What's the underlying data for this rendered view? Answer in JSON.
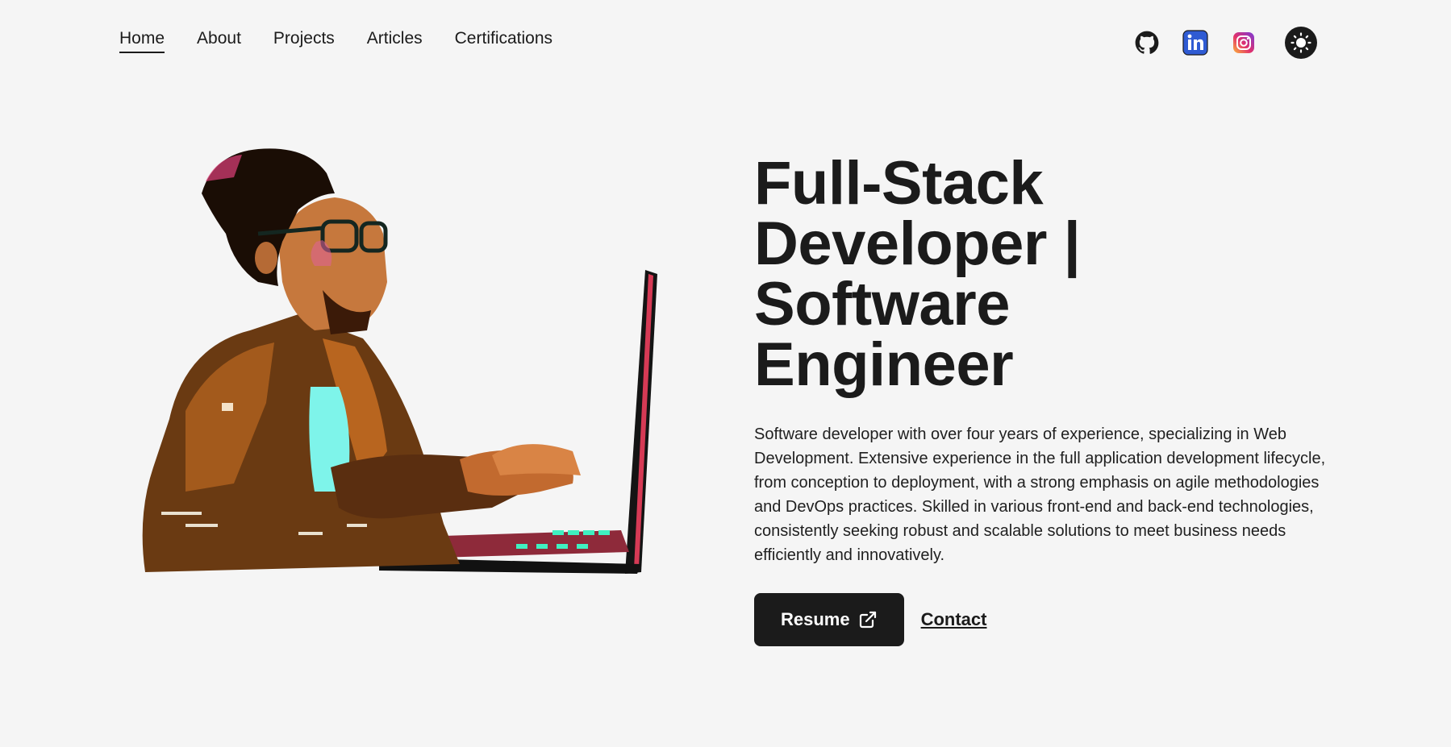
{
  "nav": {
    "items": [
      {
        "label": "Home",
        "active": true
      },
      {
        "label": "About"
      },
      {
        "label": "Projects"
      },
      {
        "label": "Articles"
      },
      {
        "label": "Certifications"
      }
    ]
  },
  "socials": {
    "icons": [
      "github-icon",
      "linkedin-icon",
      "instagram-icon"
    ],
    "theme_icon": "sun-icon"
  },
  "hero": {
    "headline": "Full-Stack Developer | Software Engineer",
    "intro": "Software developer with over four years of experience, specializing in Web Development. Extensive experience in the full application development lifecycle, from conception to deployment, with a strong emphasis on agile methodologies and DevOps practices. Skilled in various front-end and back-end technologies, consistently seeking robust and scalable solutions to meet business needs efficiently and innovatively.",
    "resume_label": "Resume",
    "contact_label": "Contact"
  },
  "colors": {
    "background": "#f5f5f5",
    "text": "#1b1b1b",
    "linkedin": "#2f5bd3"
  }
}
